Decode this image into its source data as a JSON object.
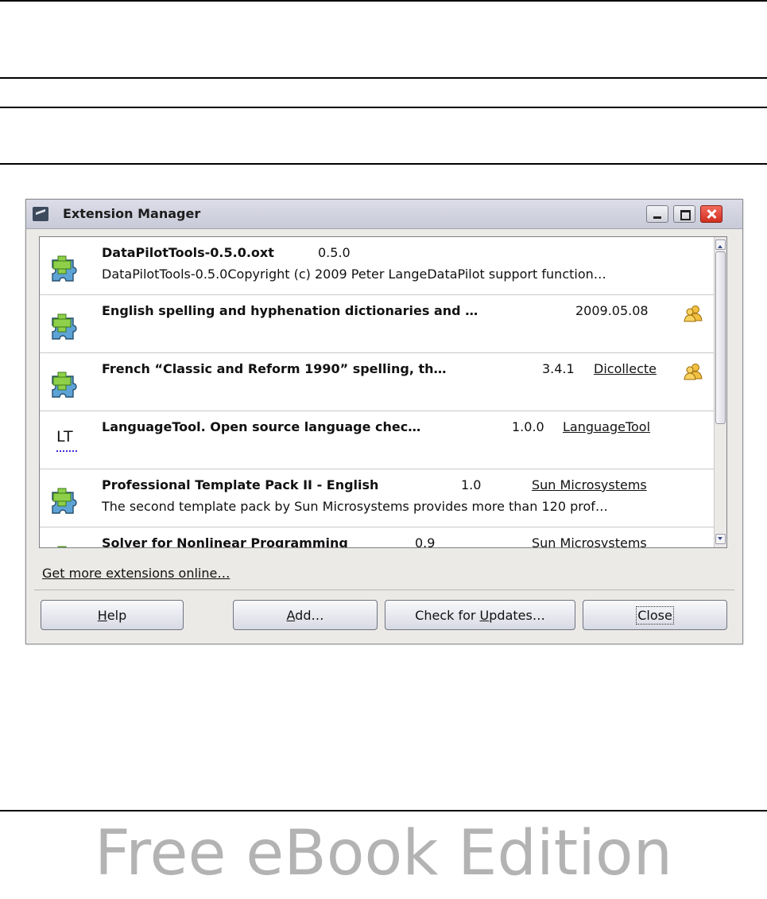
{
  "dialog": {
    "title": "Extension Manager",
    "extensions": [
      {
        "name": "DataPilotTools-0.5.0.oxt",
        "version": "0.5.0",
        "publisher": "",
        "description": "DataPilotTools-0.5.0Copyright (c) 2009 Peter LangeDataPilot support function…",
        "icon": "puzzle-icon",
        "shared": false
      },
      {
        "name": "English spelling and hyphenation dictionaries and …",
        "version": "2009.05.08",
        "publisher": "",
        "description": "",
        "icon": "puzzle-icon",
        "shared": true
      },
      {
        "name": "French “Classic and Reform 1990” spelling, th…",
        "version": "3.4.1",
        "publisher": "Dicollecte",
        "description": "",
        "icon": "puzzle-icon",
        "shared": true
      },
      {
        "name": "LanguageTool. Open source language chec…",
        "version": "1.0.0",
        "publisher": "LanguageTool",
        "description": "",
        "icon": "languagetool-icon",
        "icon_text": "LT",
        "shared": false
      },
      {
        "name": "Professional Template Pack II - English",
        "version": "1.0",
        "publisher": "Sun Microsystems",
        "description": "The second template pack by Sun Microsystems provides more than 120 prof…",
        "icon": "puzzle-icon",
        "shared": false
      },
      {
        "name": "Solver for Nonlinear Programming",
        "version": "0.9",
        "publisher": "Sun Microsystems",
        "description": "",
        "icon": "puzzle-icon",
        "shared": false
      }
    ],
    "more_link": "Get more extensions online…",
    "buttons": {
      "help": {
        "pre": "",
        "mnemonic": "H",
        "post": "elp"
      },
      "add": {
        "pre": "",
        "mnemonic": "A",
        "post": "dd…"
      },
      "updates": {
        "pre": "Check for ",
        "mnemonic": "U",
        "post": "pdates…"
      },
      "close": {
        "label": "Close"
      }
    }
  },
  "watermark": "Free eBook Edition",
  "colors": {
    "titlebar": "#c9cad8",
    "close_button": "#d12f1f",
    "puzzle_blue": "#4a8fc4",
    "puzzle_plus": "#7cc33a",
    "shared_icon": "#f0b020",
    "watermark": "#b3b3b3"
  }
}
